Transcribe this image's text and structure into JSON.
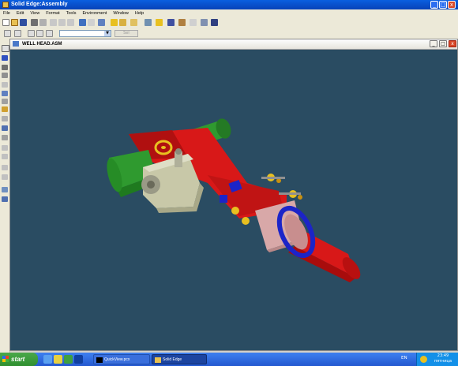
{
  "app": {
    "title": "Solid Edge:Assembly",
    "window_buttons": [
      "_",
      "□",
      "x"
    ]
  },
  "menu": {
    "items": [
      "File",
      "Edit",
      "View",
      "Format",
      "Tools",
      "Environment",
      "Window",
      "Help"
    ]
  },
  "toolbar2": {
    "combo_value": "",
    "disabled_button_label": "Sel"
  },
  "document": {
    "title": "WELL HEAD.ASM",
    "buttons": [
      "_",
      "□",
      "x"
    ],
    "viewport_background": "#2a4c62"
  },
  "model": {
    "colors": {
      "red": "#d81818",
      "green": "#2f9a2f",
      "grey": "#c8c8a8",
      "blue": "#1c24c8",
      "yellow": "#e8c020",
      "pink": "#d8a8a8"
    }
  },
  "taskbar": {
    "start_label": "start",
    "tasks": [
      "QuickView.pcx",
      "Solid Edge"
    ],
    "language": "EN",
    "clock_time": "23:49",
    "clock_day": "пятница"
  }
}
